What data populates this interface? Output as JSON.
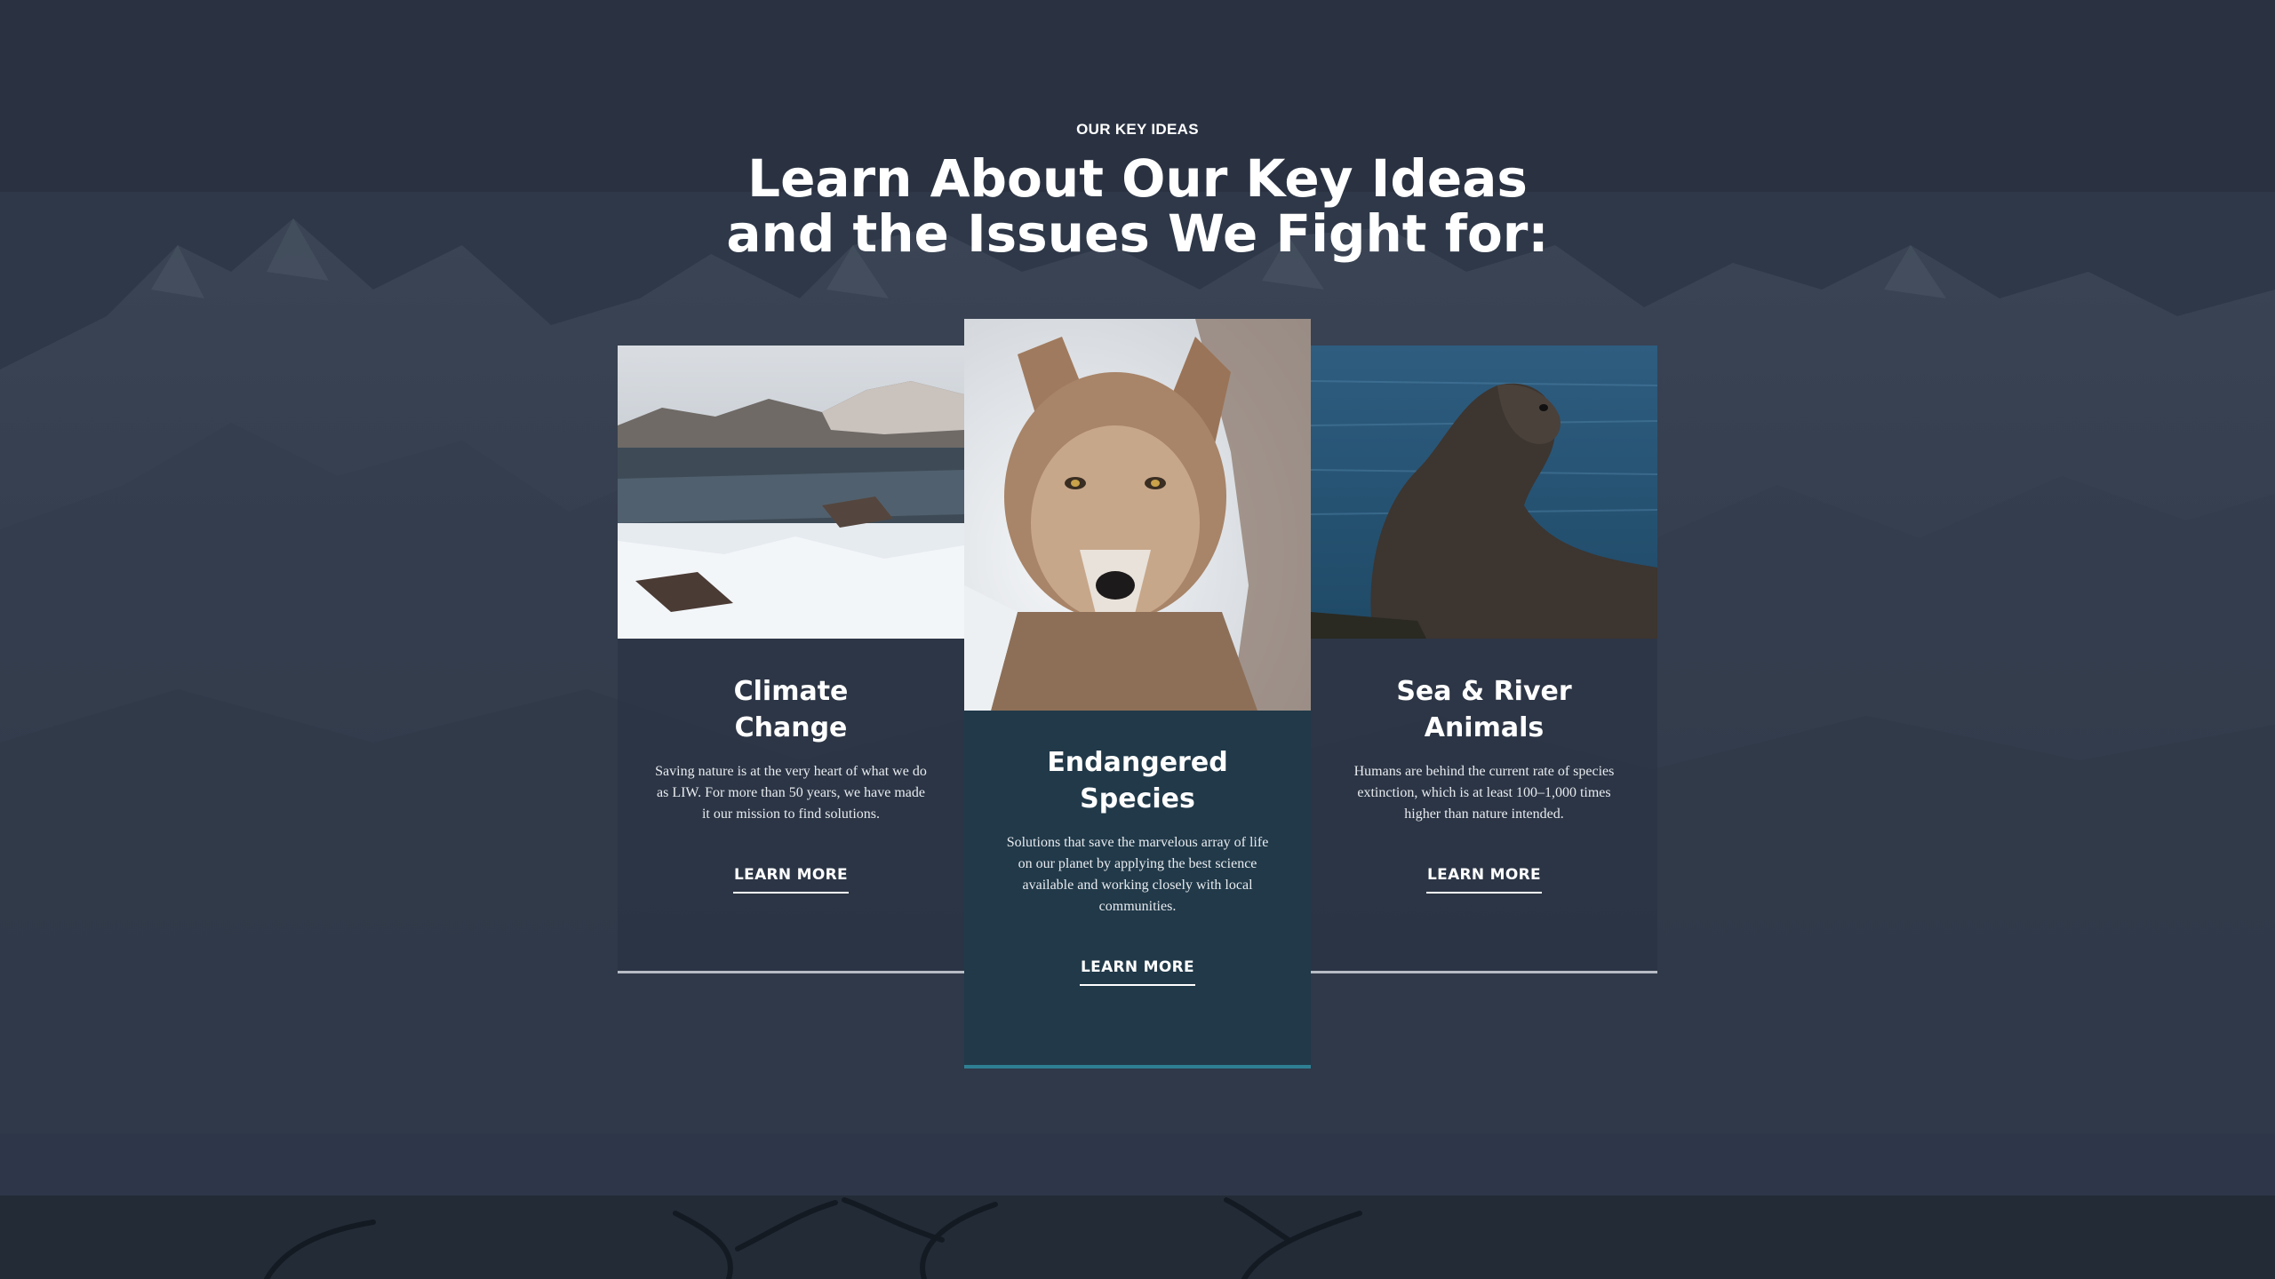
{
  "section": {
    "eyebrow": "OUR KEY IDEAS",
    "heading_line1": "Learn About Our Key Ideas",
    "heading_line2": "and the Issues We Fight for:"
  },
  "cards": [
    {
      "title_line1": "Climate",
      "title_line2": "Change",
      "text": "Saving nature is at the very heart of what we do as LIW. For more than 50 years, we have made it our mission to find solutions.",
      "cta": "LEARN MORE",
      "image": "snowy-lake-landscape"
    },
    {
      "title_line1": "Endangered",
      "title_line2": "Species",
      "text": "Solutions that save the marvelous array of life on our planet by applying the best science available and working closely with local communities.",
      "cta": "LEARN MORE",
      "image": "wolf-portrait"
    },
    {
      "title_line1": "Sea & River",
      "title_line2": "Animals",
      "text": "Humans are behind the current rate of species extinction, which is at least 100–1,000 times higher than nature intended.",
      "cta": "LEARN MORE",
      "image": "sea-lion-on-rock"
    }
  ],
  "colors": {
    "background": "#2b3444",
    "center_card": "#213949",
    "center_card_accent": "#2f7f93",
    "side_card_border": "#b7bcc4"
  }
}
